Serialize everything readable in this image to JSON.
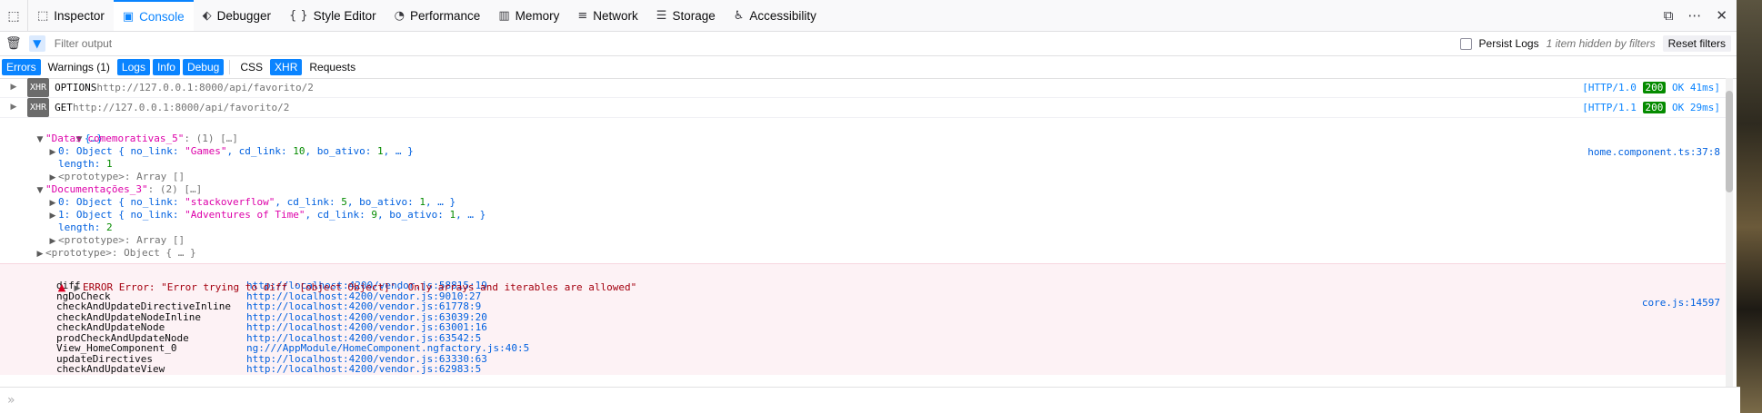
{
  "tabs": [
    {
      "label": "Inspector",
      "icon": "inspector-icon",
      "glyph": "⬚"
    },
    {
      "label": "Console",
      "icon": "console-icon",
      "glyph": "▣"
    },
    {
      "label": "Debugger",
      "icon": "debugger-icon",
      "glyph": "⬖"
    },
    {
      "label": "Style Editor",
      "icon": "style-editor-icon",
      "glyph": "{ }"
    },
    {
      "label": "Performance",
      "icon": "performance-icon",
      "glyph": "◔"
    },
    {
      "label": "Memory",
      "icon": "memory-icon",
      "glyph": "▥"
    },
    {
      "label": "Network",
      "icon": "network-icon",
      "glyph": "≡"
    },
    {
      "label": "Storage",
      "icon": "storage-icon",
      "glyph": "☰"
    },
    {
      "label": "Accessibility",
      "icon": "accessibility-icon",
      "glyph": "♿"
    }
  ],
  "active_tab": "Console",
  "filter": {
    "placeholder": "Filter output",
    "persist_logs": "Persist Logs",
    "hidden_note": "1 item hidden by filters",
    "reset": "Reset filters"
  },
  "toggles": {
    "errors": "Errors",
    "warnings": "Warnings (1)",
    "logs": "Logs",
    "info": "Info",
    "debug": "Debug",
    "css": "CSS",
    "xhr": "XHR",
    "requests": "Requests"
  },
  "requests": [
    {
      "tag": "XHR",
      "method": "OPTIONS",
      "url": "http://127.0.0.1:8000/api/favorito/2",
      "proto": "[HTTP/1.0 ",
      "code": "200",
      "tail": " OK 41ms]"
    },
    {
      "tag": "XHR",
      "method": "GET",
      "url": "http://127.0.0.1:8000/api/favorito/2",
      "proto": "[HTTP/1.1 ",
      "code": "200",
      "tail": " OK 29ms]"
    }
  ],
  "log": {
    "root": "{…}",
    "source": "home.component.ts:37:8",
    "group1_key": "\"Datas comemorativas_5\"",
    "group1_count": ": (1) […]",
    "g1_item0_prefix": "0: Object { no_link: ",
    "g1_item0_str": "\"Games\"",
    "g1_item0_mid": ", cd_link: ",
    "g1_item0_num": "10",
    "g1_item0_mid2": ", bo_ativo: ",
    "g1_item0_num2": "1",
    "g1_item0_end": ", … }",
    "g1_length_label": "length: ",
    "g1_length": "1",
    "g1_proto": "<prototype>: Array []",
    "group2_key": "\"Documentações_3\"",
    "group2_count": ": (2) […]",
    "g2_item0_prefix": "0: Object { no_link: ",
    "g2_item0_str": "\"stackoverflow\"",
    "g2_item0_mid": ", cd_link: ",
    "g2_item0_num": "5",
    "g2_item0_mid2": ", bo_ativo: ",
    "g2_item0_num2": "1",
    "g2_item0_end": ", … }",
    "g2_item1_prefix": "1: Object { no_link: ",
    "g2_item1_str": "\"Adventures of Time\"",
    "g2_item1_mid": ", cd_link: ",
    "g2_item1_num": "9",
    "g2_item1_mid2": ", bo_ativo: ",
    "g2_item1_num2": "1",
    "g2_item1_end": ", … }",
    "g2_length_label": "length: ",
    "g2_length": "2",
    "g2_proto": "<prototype>: Array []",
    "root_proto": "<prototype>: Object { … }"
  },
  "error": {
    "message": "ERROR Error: \"Error trying to diff '[object Object]'. Only arrays and iterables are allowed\"",
    "source": "core.js:14597",
    "stack": [
      {
        "fn": "diff",
        "loc": "http://localhost:4200/vendor.js:58815:19"
      },
      {
        "fn": "ngDoCheck",
        "loc": "http://localhost:4200/vendor.js:9010:27"
      },
      {
        "fn": "checkAndUpdateDirectiveInline",
        "loc": "http://localhost:4200/vendor.js:61778:9"
      },
      {
        "fn": "checkAndUpdateNodeInline",
        "loc": "http://localhost:4200/vendor.js:63039:20"
      },
      {
        "fn": "checkAndUpdateNode",
        "loc": "http://localhost:4200/vendor.js:63001:16"
      },
      {
        "fn": "prodCheckAndUpdateNode",
        "loc": "http://localhost:4200/vendor.js:63542:5"
      },
      {
        "fn": "View_HomeComponent_0",
        "loc": "ng:///AppModule/HomeComponent.ngfactory.js:40:5"
      },
      {
        "fn": "updateDirectives",
        "loc": "http://localhost:4200/vendor.js:63330:63"
      },
      {
        "fn": "checkAndUpdateView",
        "loc": "http://localhost:4200/vendor.js:62983:5"
      }
    ]
  },
  "prompt": "»"
}
